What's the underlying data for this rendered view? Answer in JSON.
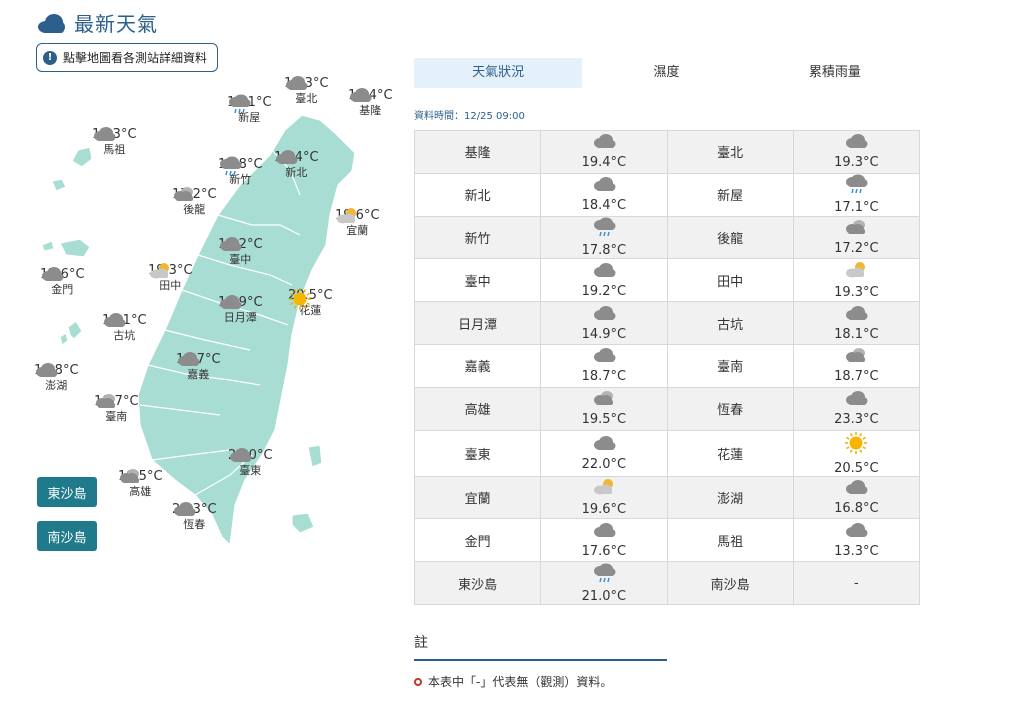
{
  "header": {
    "title": "最新天氣"
  },
  "detail_button": {
    "label": "點擊地圖看各測站詳細資料"
  },
  "tabs": [
    {
      "label": "天氣狀況"
    },
    {
      "label": "濕度"
    },
    {
      "label": "累積雨量"
    }
  ],
  "data_time": "資料時間：12/25 09:00",
  "island_buttons": {
    "dongsha": "東沙島",
    "nansha": "南沙島"
  },
  "map_stations": [
    {
      "name": "臺北",
      "temp": "19.3°C",
      "icon": "cloud-icon"
    },
    {
      "name": "基隆",
      "temp": "19.4°C",
      "icon": "cloud-icon"
    },
    {
      "name": "新屋",
      "temp": "17.1°C",
      "icon": "rain-icon"
    },
    {
      "name": "馬祖",
      "temp": "13.3°C",
      "icon": "cloud-icon"
    },
    {
      "name": "新竹",
      "temp": "17.8°C",
      "icon": "rain-icon"
    },
    {
      "name": "新北",
      "temp": "18.4°C",
      "icon": "cloud-icon"
    },
    {
      "name": "後龍",
      "temp": "17.2°C",
      "icon": "overcast-icon"
    },
    {
      "name": "宜蘭",
      "temp": "19.6°C",
      "icon": "partly-sunny-icon"
    },
    {
      "name": "臺中",
      "temp": "19.2°C",
      "icon": "cloud-icon"
    },
    {
      "name": "金門",
      "temp": "17.6°C",
      "icon": "cloud-icon"
    },
    {
      "name": "田中",
      "temp": "19.3°C",
      "icon": "partly-sunny-icon"
    },
    {
      "name": "花蓮",
      "temp": "20.5°C",
      "icon": "sun-icon"
    },
    {
      "name": "日月潭",
      "temp": "14.9°C",
      "icon": "cloud-icon"
    },
    {
      "name": "古坑",
      "temp": "18.1°C",
      "icon": "cloud-icon"
    },
    {
      "name": "嘉義",
      "temp": "18.7°C",
      "icon": "cloud-icon"
    },
    {
      "name": "澎湖",
      "temp": "16.8°C",
      "icon": "cloud-icon"
    },
    {
      "name": "臺南",
      "temp": "18.7°C",
      "icon": "overcast-icon"
    },
    {
      "name": "臺東",
      "temp": "22.0°C",
      "icon": "cloud-icon"
    },
    {
      "name": "高雄",
      "temp": "19.5°C",
      "icon": "overcast-icon"
    },
    {
      "name": "恆春",
      "temp": "23.3°C",
      "icon": "cloud-icon"
    }
  ],
  "table_rows": [
    [
      {
        "name": "基隆",
        "temp": "19.4°C",
        "icon": "cloud-icon"
      },
      {
        "name": "臺北",
        "temp": "19.3°C",
        "icon": "cloud-icon"
      }
    ],
    [
      {
        "name": "新北",
        "temp": "18.4°C",
        "icon": "cloud-icon"
      },
      {
        "name": "新屋",
        "temp": "17.1°C",
        "icon": "rain-icon"
      }
    ],
    [
      {
        "name": "新竹",
        "temp": "17.8°C",
        "icon": "rain-icon"
      },
      {
        "name": "後龍",
        "temp": "17.2°C",
        "icon": "overcast-icon"
      }
    ],
    [
      {
        "name": "臺中",
        "temp": "19.2°C",
        "icon": "cloud-icon"
      },
      {
        "name": "田中",
        "temp": "19.3°C",
        "icon": "partly-sunny-icon"
      }
    ],
    [
      {
        "name": "日月潭",
        "temp": "14.9°C",
        "icon": "cloud-icon"
      },
      {
        "name": "古坑",
        "temp": "18.1°C",
        "icon": "cloud-icon"
      }
    ],
    [
      {
        "name": "嘉義",
        "temp": "18.7°C",
        "icon": "cloud-icon"
      },
      {
        "name": "臺南",
        "temp": "18.7°C",
        "icon": "overcast-icon"
      }
    ],
    [
      {
        "name": "高雄",
        "temp": "19.5°C",
        "icon": "overcast-icon"
      },
      {
        "name": "恆春",
        "temp": "23.3°C",
        "icon": "cloud-icon"
      }
    ],
    [
      {
        "name": "臺東",
        "temp": "22.0°C",
        "icon": "cloud-icon"
      },
      {
        "name": "花蓮",
        "temp": "20.5°C",
        "icon": "sun-icon"
      }
    ],
    [
      {
        "name": "宜蘭",
        "temp": "19.6°C",
        "icon": "partly-sunny-icon"
      },
      {
        "name": "澎湖",
        "temp": "16.8°C",
        "icon": "cloud-icon"
      }
    ],
    [
      {
        "name": "金門",
        "temp": "17.6°C",
        "icon": "cloud-icon"
      },
      {
        "name": "馬祖",
        "temp": "13.3°C",
        "icon": "cloud-icon"
      }
    ],
    [
      {
        "name": "東沙島",
        "temp": "21.0°C",
        "icon": "rain-icon"
      },
      {
        "name": "南沙島",
        "temp": "-",
        "icon": ""
      }
    ]
  ],
  "note": {
    "title": "註",
    "text": "本表中「-」代表無（觀測）資料。"
  },
  "colors": {
    "accent": "#2d5f8b",
    "map_fill": "#a8ddd3",
    "island_button": "#1f7a8c"
  }
}
